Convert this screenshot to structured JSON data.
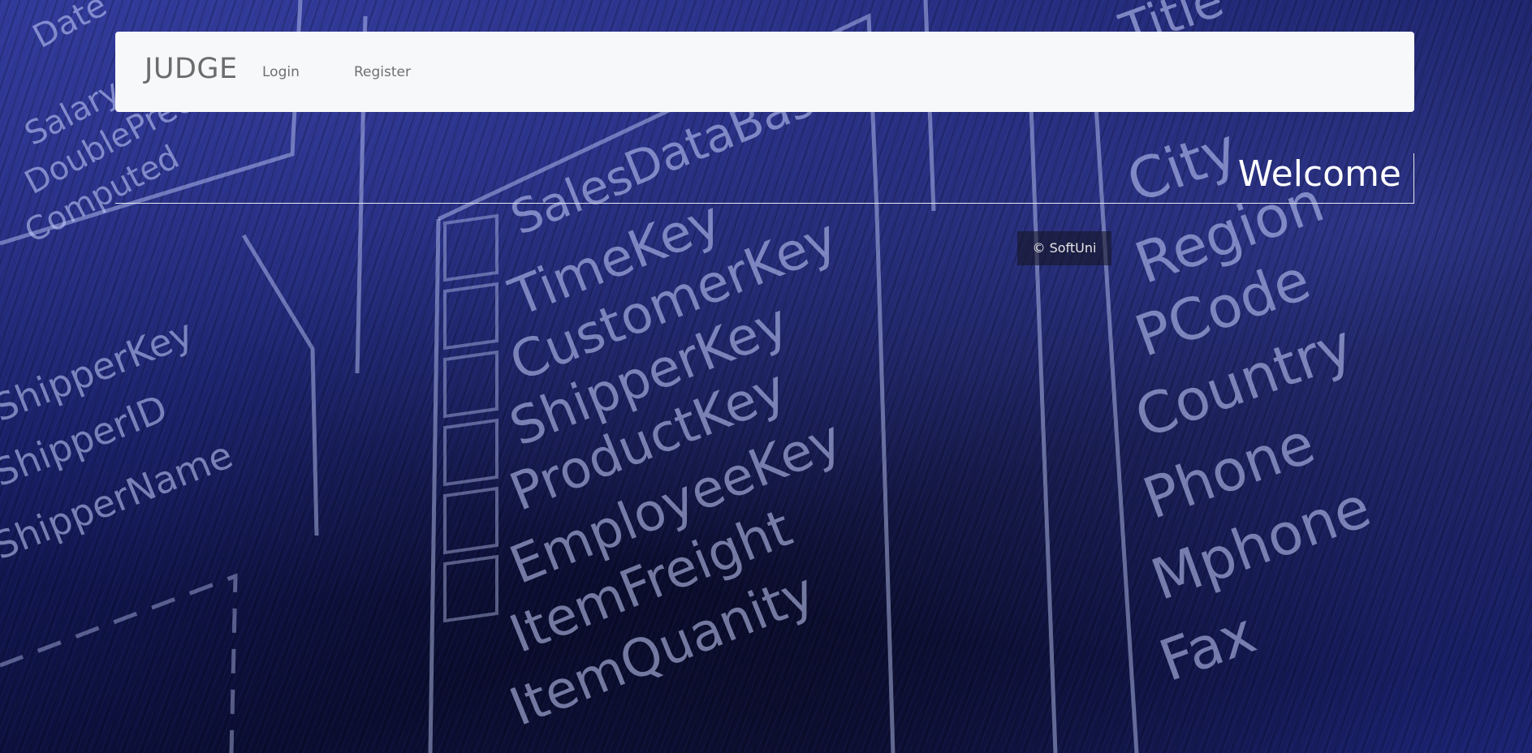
{
  "navbar": {
    "brand": "JUDGE",
    "links": [
      {
        "label": "Login"
      },
      {
        "label": "Register"
      }
    ]
  },
  "main": {
    "heading": "Welcome"
  },
  "footer": {
    "text": "© SoftUni"
  },
  "background": {
    "words": [
      "Sales",
      "DataBase",
      "TimeKey",
      "CustomerKey",
      "ShipperKey",
      "ProductKey",
      "EmployeeKey",
      "ItemFreight",
      "ItemQuanity",
      "City",
      "Region",
      "PCode",
      "Country",
      "Phone",
      "Mphone",
      "Fax",
      "Title",
      "ShipperKey",
      "ShipperID",
      "ShipperName",
      "Computed",
      "DoublePrec",
      "Salary",
      "Date"
    ],
    "colors": {
      "deep": "#0a0d32",
      "mid": "#141a5c",
      "light": "#2a3390"
    }
  }
}
